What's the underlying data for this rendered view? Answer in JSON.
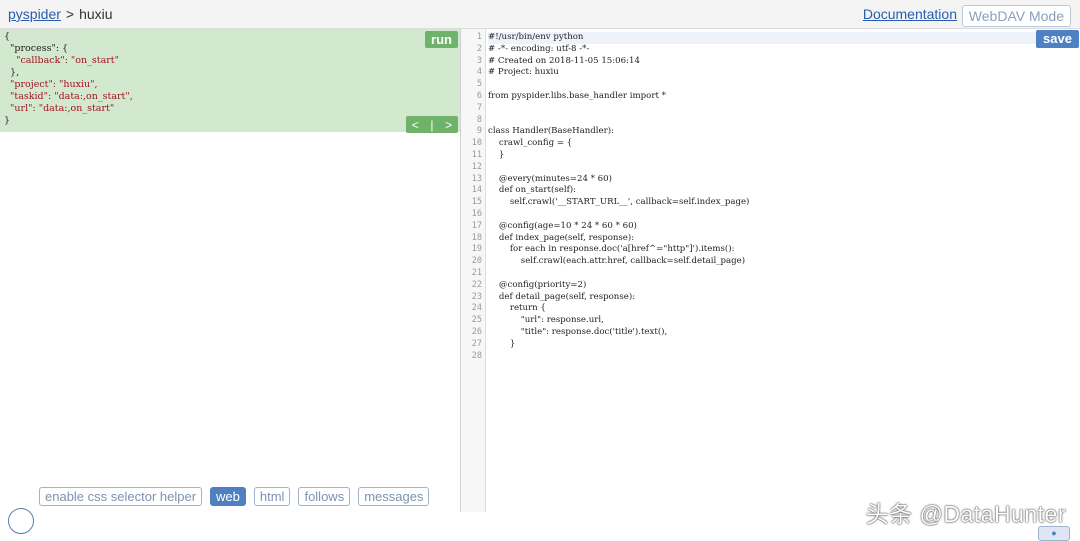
{
  "header": {
    "project_link": "pyspider",
    "separator": ">",
    "project_name": "huxiu",
    "documentation": "Documentation",
    "webdav": "WebDAV Mode"
  },
  "task_panel": {
    "json_lines": [
      "{",
      "  \"process\": {",
      "    \"callback\": \"on_start\"",
      "  },",
      "  \"project\": \"huxiu\",",
      "  \"taskid\": \"data:,on_start\",",
      "  \"url\": \"data:,on_start\"",
      "}"
    ],
    "run_label": "run",
    "prev_label": "<",
    "divider_label": "|",
    "next_label": ">"
  },
  "bottom_tabs": [
    {
      "label": "enable css selector helper"
    },
    {
      "label": "web"
    },
    {
      "label": "html"
    },
    {
      "label": "follows"
    },
    {
      "label": "messages"
    }
  ],
  "editor": {
    "save_label": "save",
    "line_numbers": [
      "1",
      "2",
      "3",
      "4",
      "5",
      "6",
      "7",
      "8",
      "9",
      "10",
      "11",
      "12",
      "13",
      "14",
      "15",
      "16",
      "17",
      "18",
      "19",
      "20",
      "21",
      "22",
      "23",
      "24",
      "25",
      "26",
      "27",
      "28"
    ],
    "code_lines": [
      "#!/usr/bin/env python",
      "# -*- encoding: utf-8 -*-",
      "# Created on 2018-11-05 15:06:14",
      "# Project: huxiu",
      "",
      "from pyspider.libs.base_handler import *",
      "",
      "",
      "class Handler(BaseHandler):",
      "    crawl_config = {",
      "    }",
      "",
      "    @every(minutes=24 * 60)",
      "    def on_start(self):",
      "        self.crawl('__START_URL__', callback=self.index_page)",
      "",
      "    @config(age=10 * 24 * 60 * 60)",
      "    def index_page(self, response):",
      "        for each in response.doc('a[href^=\"http\"]').items():",
      "            self.crawl(each.attr.href, callback=self.detail_page)",
      "",
      "    @config(priority=2)",
      "    def detail_page(self, response):",
      "        return {",
      "            \"url\": response.url,",
      "            \"title\": response.doc('title').text(),",
      "        }",
      ""
    ]
  },
  "watermark": "头条 @DataHunter",
  "colors": {
    "accent": "#4f81c2",
    "run_green": "#6fb26a",
    "task_bg": "#d2e8cf"
  }
}
